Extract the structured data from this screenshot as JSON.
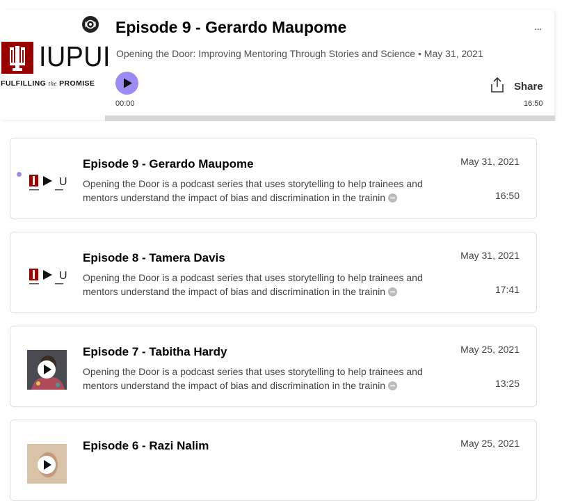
{
  "header": {
    "title": "Episode 9 - Gerardo Maupome",
    "show_name": "Opening the Door: Improving Mentoring Through Stories and Science",
    "separator": "•",
    "date": "May 31, 2021",
    "more_label": "...",
    "share_label": "Share",
    "time_current": "00:00",
    "time_total": "16:50",
    "progress_fraction": 0.0,
    "logo": {
      "wordmark": "IUPUI",
      "tagline_a": "FULFILLING",
      "tagline_b": "the",
      "tagline_c": "PROMISE"
    }
  },
  "episodes": [
    {
      "title": "Episode 9 - Gerardo Maupome",
      "description": "Opening the Door is a podcast series that uses storytelling to help trainees and mentors understand the impact of bias and discrimination in the trainin",
      "date": "May 31, 2021",
      "duration": "16:50",
      "thumb": "iupui-logo",
      "unplayed": true
    },
    {
      "title": "Episode 8 - Tamera Davis",
      "description": "Opening the Door is a podcast series that uses storytelling to help trainees and mentors understand the impact of bias and discrimination in the trainin",
      "date": "May 31, 2021",
      "duration": "17:41",
      "thumb": "iupui-logo",
      "unplayed": false
    },
    {
      "title": "Episode 7 - Tabitha Hardy",
      "description": "Opening the Door is a podcast series that uses storytelling to help trainees and mentors understand the impact of bias and discrimination in the trainin",
      "date": "May 25, 2021",
      "duration": "13:25",
      "thumb": "portrait-photo",
      "unplayed": false
    },
    {
      "title": "Episode 6 - Razi Nalim",
      "description": "",
      "date": "May 25, 2021",
      "duration": "",
      "thumb": "portrait-photo",
      "unplayed": false
    }
  ],
  "icons": {
    "play": "play-icon",
    "share": "share-icon",
    "more": "more-dots-icon",
    "podcast": "podcast-icon",
    "ellipsis": "ellipsis-icon"
  },
  "colors": {
    "accent": "#9a8cf2",
    "brand_red": "#990000",
    "track": "#d6d6d6"
  }
}
